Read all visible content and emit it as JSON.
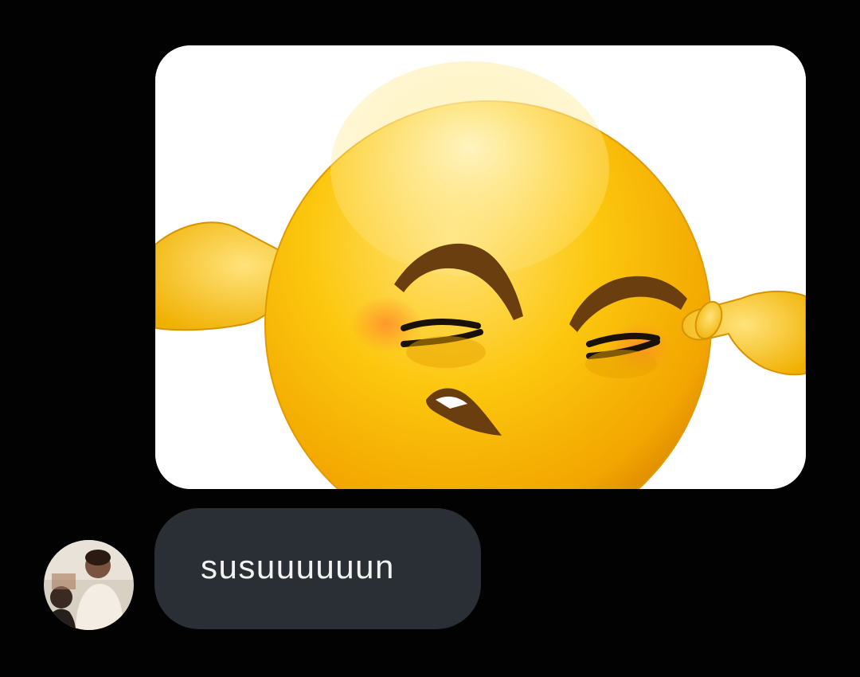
{
  "conversation": {
    "messages": [
      {
        "type": "image",
        "content": "emoji-covering-ears-sticker"
      },
      {
        "type": "text",
        "text": "susuuuuuun",
        "sender_avatar": "profile-photo"
      }
    ]
  },
  "colors": {
    "background": "#020202",
    "bubble": "#2a2f36",
    "bubble_text": "#f2f2f2",
    "emoji_yellow": "#f6b800",
    "emoji_highlight": "#ffec98",
    "emoji_brown": "#6b3e10"
  }
}
